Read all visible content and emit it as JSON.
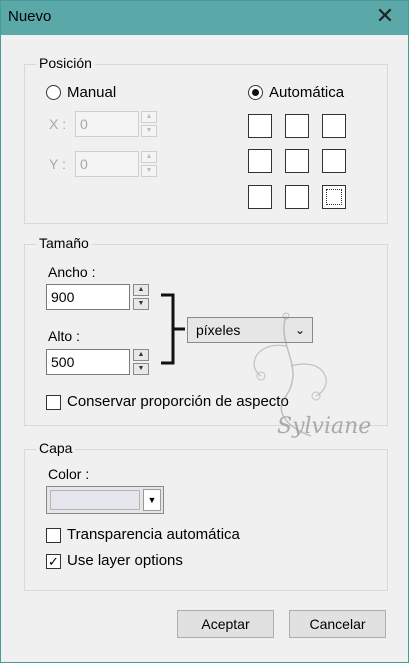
{
  "window": {
    "title": "Nuevo"
  },
  "posicion": {
    "group_label": "Posición",
    "manual_label": "Manual",
    "auto_label": "Automática",
    "x_label": "X :",
    "x_value": "0",
    "y_label": "Y :",
    "y_value": "0"
  },
  "tamano": {
    "group_label": "Tamaño",
    "ancho_label": "Ancho :",
    "ancho_value": "900",
    "alto_label": "Alto :",
    "alto_value": "500",
    "unit_value": "píxeles",
    "keep_ratio_label": "Conservar proporción de aspecto"
  },
  "capa": {
    "group_label": "Capa",
    "color_label": "Color :",
    "transparency_label": "Transparencia automática",
    "layer_options_label": "Use layer options"
  },
  "buttons": {
    "ok": "Aceptar",
    "cancel": "Cancelar"
  },
  "watermark": {
    "text": "Sylviane"
  }
}
